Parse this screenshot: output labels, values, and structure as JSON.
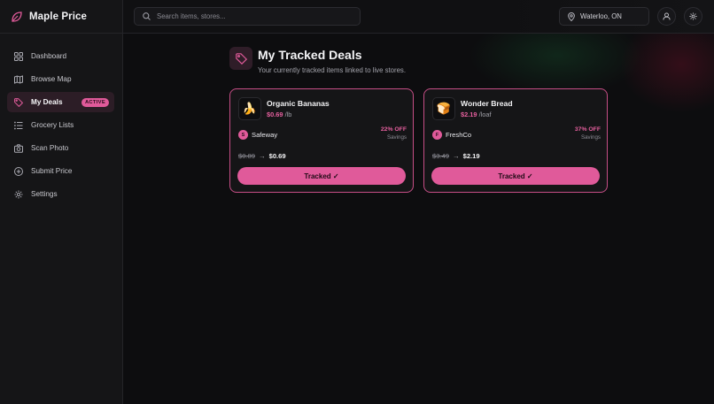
{
  "brand": {
    "name": "Maple Price"
  },
  "search": {
    "placeholder": "Search items, stores..."
  },
  "location": {
    "label": "Waterloo, ON"
  },
  "sidebar": {
    "items": [
      {
        "label": "Dashboard",
        "icon": "grid-icon"
      },
      {
        "label": "Browse Map",
        "icon": "map-icon"
      },
      {
        "label": "My Deals",
        "icon": "tag-icon",
        "badge": "ACTIVE",
        "active": true
      },
      {
        "label": "Grocery Lists",
        "icon": "list-icon"
      },
      {
        "label": "Scan Photo",
        "icon": "camera-icon"
      },
      {
        "label": "Submit Price",
        "icon": "plus-circle-icon"
      },
      {
        "label": "Settings",
        "icon": "gear-icon"
      }
    ]
  },
  "page": {
    "title": "My Tracked Deals",
    "subtitle": "Your currently tracked items linked to live stores."
  },
  "deals": [
    {
      "name": "Organic Bananas",
      "price": "$0.69",
      "unit": "/lb",
      "store_initial": "S",
      "store": "Safeway",
      "off": "22% OFF",
      "savings_label": "Savings",
      "old_price": "$0.89",
      "arrow": "→",
      "new_price": "$0.69",
      "button": "Tracked ✓",
      "emoji": "🍌"
    },
    {
      "name": "Wonder Bread",
      "price": "$2.19",
      "unit": "/loaf",
      "store_initial": "F",
      "store": "FreshCo",
      "off": "37% OFF",
      "savings_label": "Savings",
      "old_price": "$3.49",
      "arrow": "→",
      "new_price": "$2.19",
      "button": "Tracked ✓",
      "emoji": "🍞"
    }
  ],
  "colors": {
    "accent": "#e05a9a",
    "background": "#0d0d0f",
    "sidebar": "#151517"
  }
}
